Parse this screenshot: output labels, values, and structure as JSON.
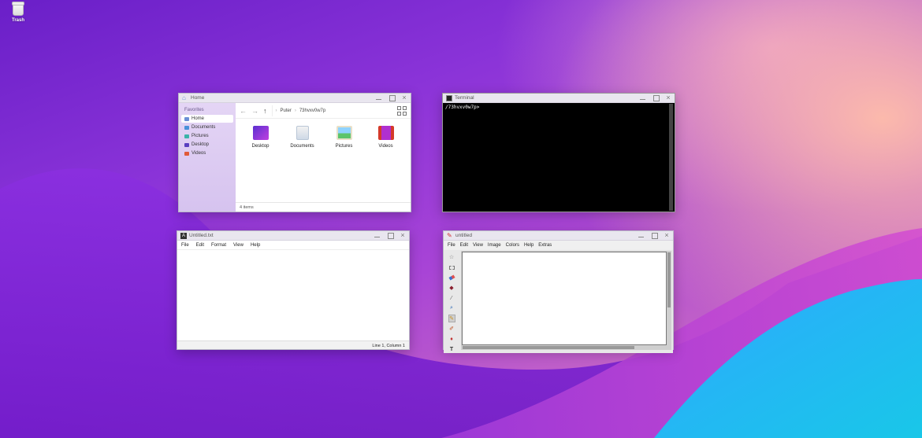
{
  "desktop": {
    "icons": [
      {
        "label": "Trash",
        "icon": "trash-icon"
      }
    ]
  },
  "file_manager": {
    "title": "Home",
    "sidebar_section": "Favorites",
    "sidebar_items": [
      {
        "label": "Home",
        "icon": "home-icon",
        "color": "#6b8fd6"
      },
      {
        "label": "Documents",
        "icon": "documents-icon",
        "color": "#4a90d9"
      },
      {
        "label": "Pictures",
        "icon": "pictures-icon",
        "color": "#3bb3a8"
      },
      {
        "label": "Desktop",
        "icon": "desktop-icon",
        "color": "#5a3fc0"
      },
      {
        "label": "Videos",
        "icon": "videos-icon",
        "color": "#e05a3a"
      }
    ],
    "breadcrumb": [
      "Puter",
      "73hvxv0w7p"
    ],
    "files": [
      {
        "label": "Desktop",
        "icon": "desktop-folder-icon"
      },
      {
        "label": "Documents",
        "icon": "documents-folder-icon"
      },
      {
        "label": "Pictures",
        "icon": "pictures-folder-icon"
      },
      {
        "label": "Videos",
        "icon": "videos-folder-icon"
      }
    ],
    "status": "4 items"
  },
  "terminal": {
    "title": "Terminal",
    "prompt": "/73hvxv0w7p>"
  },
  "notepad": {
    "title": "Untitled.txt",
    "menu": [
      "File",
      "Edit",
      "Format",
      "View",
      "Help"
    ],
    "status": "Line 1, Column 1"
  },
  "paint": {
    "title": "untitled",
    "menu": [
      "File",
      "Edit",
      "View",
      "Image",
      "Colors",
      "Help",
      "Extras"
    ],
    "tools": [
      "select-icon",
      "rect-select-icon",
      "eraser-icon",
      "fill-icon",
      "eyedropper-icon",
      "magnifier-icon",
      "pencil-icon",
      "brush-icon",
      "airbrush-icon",
      "text-icon"
    ]
  }
}
